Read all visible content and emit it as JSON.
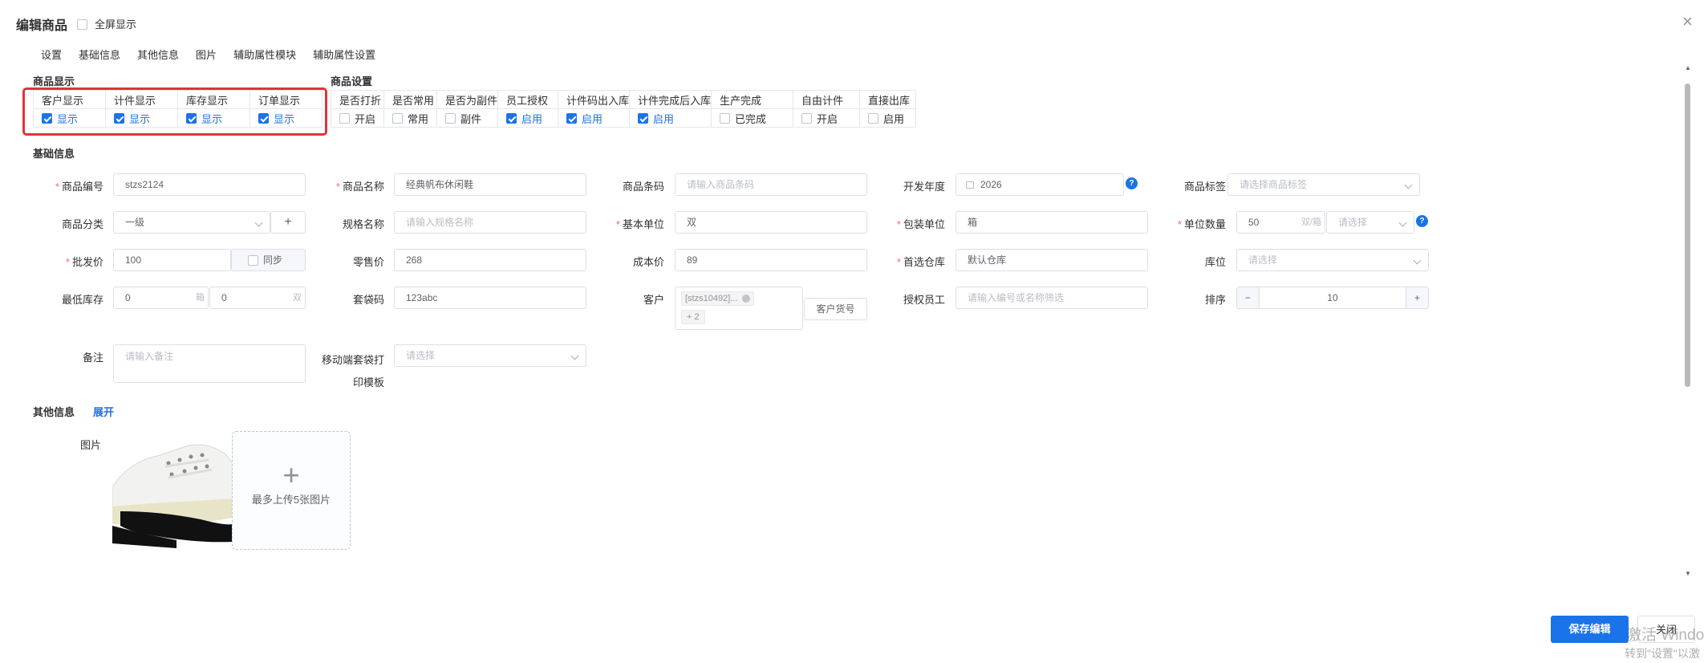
{
  "dialog": {
    "title": "编辑商品",
    "fullscreen_label": "全屏显示",
    "close_icon": "×"
  },
  "nav": [
    "设置",
    "基础信息",
    "其他信息",
    "图片",
    "辅助属性模块",
    "辅助属性设置"
  ],
  "display_section": {
    "title": "商品显示",
    "headers": [
      "客户显示",
      "计件显示",
      "库存显示",
      "订单显示"
    ],
    "values": [
      "显示",
      "显示",
      "显示",
      "显示"
    ]
  },
  "settings_section": {
    "title": "商品设置",
    "headers": [
      "是否打折",
      "是否常用",
      "是否为副件",
      "员工授权",
      "计件码出入库",
      "计件完成后入库",
      "生产完成",
      "自由计件",
      "直接出库"
    ],
    "values": [
      "开启",
      "常用",
      "副件",
      "启用",
      "启用",
      "启用",
      "已完成",
      "开启",
      "启用"
    ],
    "checked": [
      false,
      false,
      false,
      true,
      true,
      true,
      false,
      false,
      false
    ]
  },
  "basic": {
    "title": "基础信息",
    "code_label": "商品编号",
    "code_value": "stzs2124",
    "name_label": "商品名称",
    "name_value": "经典帆布休闲鞋",
    "barcode_label": "商品条码",
    "barcode_ph": "请输入商品条码",
    "year_label": "开发年度",
    "year_value": "2026",
    "tag_label": "商品标签",
    "tag_ph": "请选择商品标签",
    "category_label": "商品分类",
    "category_value": "一级",
    "plus": "+",
    "spec_label": "规格名称",
    "spec_ph": "请输入规格名称",
    "unit_label": "基本单位",
    "unit_value": "双",
    "pack_label": "包装单位",
    "pack_value": "箱",
    "qty_label": "单位数量",
    "qty_value": "50",
    "qty_unit": "双/箱",
    "qty_select_ph": "请选择",
    "wholesale_label": "批发价",
    "wholesale_value": "100",
    "sync_label": "同步",
    "retail_label": "零售价",
    "retail_value": "268",
    "cost_label": "成本价",
    "cost_value": "89",
    "warehouse_label": "首选仓库",
    "warehouse_value": "默认仓库",
    "location_label": "库位",
    "location_ph": "请选择",
    "minstock_label": "最低库存",
    "minstock_v1": "0",
    "minstock_u1": "箱",
    "minstock_v2": "0",
    "minstock_u2": "双",
    "bagcode_label": "套袋码",
    "bagcode_value": "123abc",
    "customer_label": "客户",
    "customer_tag": "[stzs10492]...",
    "customer_more": "+ 2",
    "customer_btn": "客户货号",
    "staff_label": "授权员工",
    "staff_ph": "请输入编号或名称筛选",
    "sort_label": "排序",
    "sort_value": "10",
    "sort_minus": "−",
    "sort_plus": "+",
    "remark_label": "备注",
    "remark_ph": "请输入备注",
    "mobile_label_1": "移动端套袋打",
    "mobile_label_2": "印模板",
    "mobile_ph": "请选择"
  },
  "other": {
    "title": "其他信息",
    "expand": "展开"
  },
  "images": {
    "label": "图片",
    "upload_hint": "最多上传5张图片",
    "upload_plus": "+"
  },
  "footer": {
    "save": "保存编辑",
    "close": "关闭"
  },
  "watermark": {
    "line1": "激活 Windo",
    "line2": "转到\"设置\"以激"
  }
}
